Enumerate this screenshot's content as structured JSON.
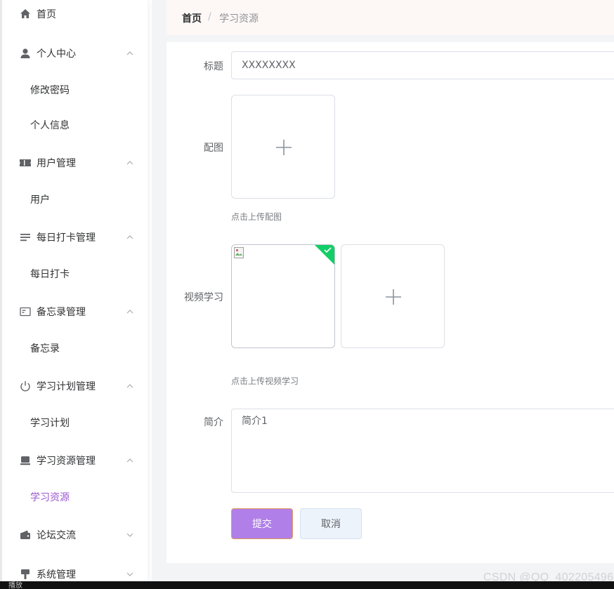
{
  "sidebar": {
    "items": [
      {
        "type": "menu",
        "label": "首页",
        "icon": "home-icon",
        "chevron": "none"
      },
      {
        "type": "menu",
        "label": "个人中心",
        "icon": "user-icon",
        "chevron": "up"
      },
      {
        "type": "sub",
        "label": "修改密码"
      },
      {
        "type": "sub",
        "label": "个人信息"
      },
      {
        "type": "menu",
        "label": "用户管理",
        "icon": "ticket-icon",
        "chevron": "up"
      },
      {
        "type": "sub",
        "label": "用户"
      },
      {
        "type": "menu",
        "label": "每日打卡管理",
        "icon": "list-icon",
        "chevron": "up"
      },
      {
        "type": "sub",
        "label": "每日打卡"
      },
      {
        "type": "menu",
        "label": "备忘录管理",
        "icon": "memo-icon",
        "chevron": "up"
      },
      {
        "type": "sub",
        "label": "备忘录"
      },
      {
        "type": "menu",
        "label": "学习计划管理",
        "icon": "power-icon",
        "chevron": "up"
      },
      {
        "type": "sub",
        "label": "学习计划"
      },
      {
        "type": "menu",
        "label": "学习资源管理",
        "icon": "monitor-icon",
        "chevron": "up"
      },
      {
        "type": "sub",
        "label": "学习资源",
        "active": true
      },
      {
        "type": "menu",
        "label": "论坛交流",
        "icon": "wallet-icon",
        "chevron": "down"
      },
      {
        "type": "menu",
        "label": "系统管理",
        "icon": "tool-icon",
        "chevron": "down"
      }
    ]
  },
  "breadcrumb": {
    "home": "首页",
    "separator": "/",
    "current": "学习资源"
  },
  "form": {
    "title_label": "标题",
    "title_value": "XXXXXXXX",
    "image_label": "配图",
    "image_tip": "点击上传配图",
    "video_label": "视频学习",
    "video_tip": "点击上传视频学习",
    "intro_label": "简介",
    "intro_value": "简介1",
    "submit_label": "提交",
    "cancel_label": "取消"
  },
  "watermark": "CSDN @QQ_402205496",
  "taskbar_text": "播放",
  "colors": {
    "accent": "#9b59d0",
    "submit_bg": "#b07fe8",
    "success_badge": "#13ce66"
  }
}
